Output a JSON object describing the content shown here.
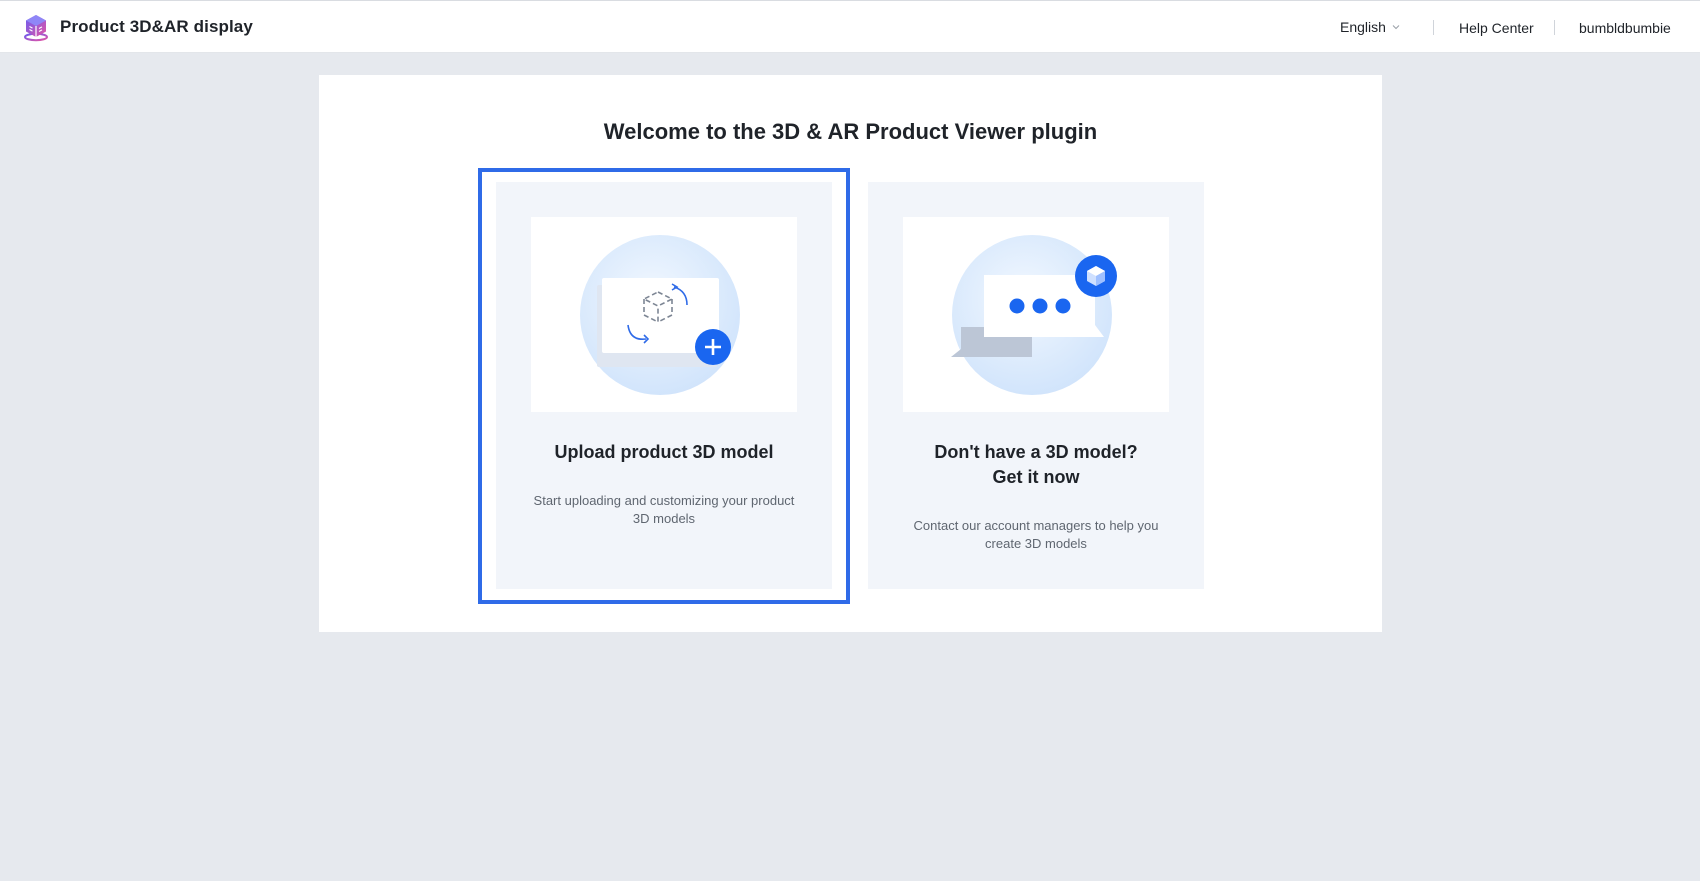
{
  "header": {
    "app_title": "Product 3D&AR display",
    "logo_icon": "cube-logo-icon",
    "language": "English",
    "help_center": "Help Center",
    "username": "bumbldbumbie"
  },
  "main": {
    "welcome_title": "Welcome to the 3D & AR Product Viewer plugin",
    "cards": [
      {
        "title": "Upload product 3D model",
        "description": "Start uploading and customizing your product 3D models",
        "icon": "upload-3d-model-illustration",
        "selected": true
      },
      {
        "title_line1": "Don't have a 3D model?",
        "title_line2": "Get it now",
        "description": "Contact our account managers to help you create 3D models",
        "icon": "chat-3d-model-illustration",
        "selected": false
      }
    ]
  },
  "colors": {
    "accent": "#2f6be8",
    "icon_blue": "#1a66f0",
    "page_bg": "#e6e9ee",
    "card_bg": "#f2f5fa"
  }
}
